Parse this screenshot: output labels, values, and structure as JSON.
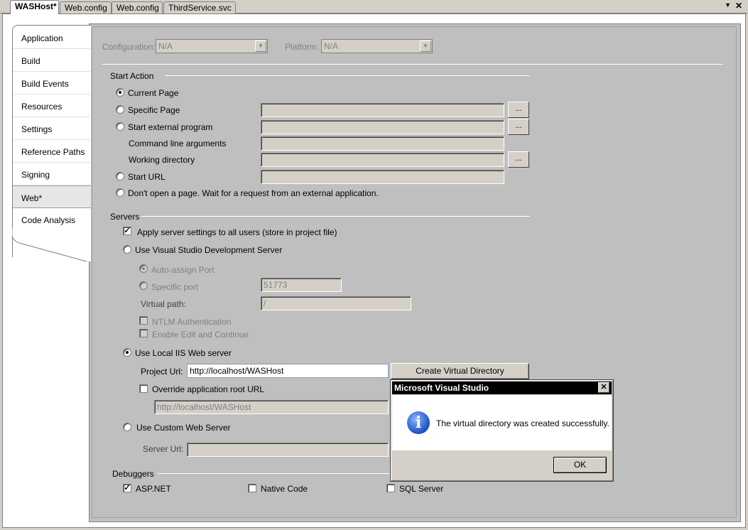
{
  "doc_tabs": [
    {
      "label": "WASHost*",
      "active": true
    },
    {
      "label": "Web.config",
      "active": false
    },
    {
      "label": "Web.config",
      "active": false
    },
    {
      "label": "ThirdService.svc",
      "active": false
    }
  ],
  "nav": {
    "items": [
      {
        "label": "Application"
      },
      {
        "label": "Build"
      },
      {
        "label": "Build Events"
      },
      {
        "label": "Resources"
      },
      {
        "label": "Settings"
      },
      {
        "label": "Reference Paths"
      },
      {
        "label": "Signing"
      },
      {
        "label": "Web*",
        "selected": true
      },
      {
        "label": "Code Analysis"
      }
    ]
  },
  "config": {
    "configuration_label": "Configuration:",
    "configuration_value": "N/A",
    "platform_label": "Platform:",
    "platform_value": "N/A"
  },
  "start_action": {
    "heading": "Start Action",
    "current_page": "Current Page",
    "specific_page": "Specific Page",
    "start_external_program": "Start external program",
    "command_line_arguments": "Command line arguments",
    "working_directory": "Working directory",
    "start_url": "Start URL",
    "dont_open": "Don't open a page.  Wait for a request from an external application.",
    "browse_label": "...",
    "selected": "current_page"
  },
  "servers": {
    "heading": "Servers",
    "apply_settings": "Apply server settings to all users (store in project file)",
    "apply_settings_checked": true,
    "use_vs_dev_server": "Use Visual Studio Development Server",
    "auto_assign_port": "Auto-assign Port",
    "specific_port": "Specific port",
    "specific_port_value": "51773",
    "virtual_path_label": "Virtual path:",
    "virtual_path_value": "/",
    "ntlm_auth": "NTLM Authentication",
    "enable_edit_continue": "Enable Edit and Continue",
    "use_local_iis": "Use Local IIS Web server",
    "project_url_label": "Project Url:",
    "project_url_value": "http://localhost/WASHost",
    "create_virtual_directory": "Create Virtual Directory",
    "override_root_url": "Override application root URL",
    "override_root_url_value": "http://localhost/WASHost",
    "use_custom_web_server": "Use Custom Web Server",
    "server_url_label": "Server Url:",
    "server_url_value": ""
  },
  "debuggers": {
    "heading": "Debuggers",
    "aspnet": "ASP.NET",
    "aspnet_checked": true,
    "native_code": "Native Code",
    "native_code_checked": false,
    "sql_server": "SQL Server",
    "sql_server_checked": false
  },
  "dialog": {
    "title": "Microsoft Visual Studio",
    "message": "The virtual directory was created successfully.",
    "ok_label": "OK",
    "close_glyph": "✕",
    "icon": "info-icon"
  },
  "window": {
    "dropdown_glyph": "▼",
    "close_glyph": "✕"
  }
}
